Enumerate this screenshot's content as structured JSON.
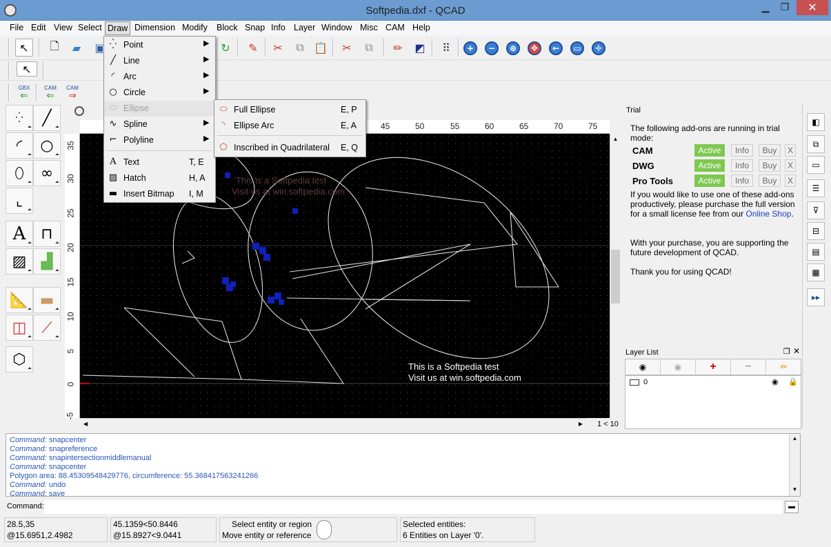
{
  "window": {
    "title": "Softpedia.dxf - QCAD",
    "minimize": "▁",
    "maximize": "❐",
    "close": "✕"
  },
  "menubar": [
    "File",
    "Edit",
    "View",
    "Select",
    "Draw",
    "Dimension",
    "Modify",
    "Block",
    "Snap",
    "Info",
    "Layer",
    "Window",
    "Misc",
    "CAM",
    "Help"
  ],
  "cam_buttons": {
    "gbx": "GBX",
    "cam1": "CAM",
    "cam2": "CAM"
  },
  "draw_menu": {
    "items": [
      {
        "label": "Point",
        "shortcut": "",
        "submenu": true,
        "icon": "point-icon",
        "glyph": "⁛"
      },
      {
        "label": "Line",
        "shortcut": "",
        "submenu": true,
        "icon": "line-icon",
        "glyph": "╱"
      },
      {
        "label": "Arc",
        "shortcut": "",
        "submenu": true,
        "icon": "arc-icon",
        "glyph": "◜"
      },
      {
        "label": "Circle",
        "shortcut": "",
        "submenu": true,
        "icon": "circle-icon",
        "glyph": "○"
      },
      {
        "label": "Ellipse",
        "shortcut": "",
        "submenu": true,
        "icon": "ellipse-icon",
        "glyph": "⬭",
        "disabled": true
      },
      {
        "label": "Spline",
        "shortcut": "",
        "submenu": true,
        "icon": "spline-icon",
        "glyph": "∿"
      },
      {
        "label": "Polyline",
        "shortcut": "",
        "submenu": true,
        "icon": "polyline-icon",
        "glyph": "⌐"
      },
      {
        "label": "Text",
        "shortcut": "T, E",
        "submenu": false,
        "icon": "text-icon",
        "glyph": "A"
      },
      {
        "label": "Hatch",
        "shortcut": "H, A",
        "submenu": false,
        "icon": "hatch-icon",
        "glyph": "▨"
      },
      {
        "label": "Insert Bitmap",
        "shortcut": "I, M",
        "submenu": false,
        "icon": "bitmap-icon",
        "glyph": "▬"
      }
    ],
    "arrow": "▶"
  },
  "ellipse_submenu": [
    {
      "label": "Full Ellipse",
      "shortcut": "E, P"
    },
    {
      "label": "Ellipse Arc",
      "shortcut": "E, A"
    },
    {
      "label": "Inscribed in Quadrilateral",
      "shortcut": "E, Q"
    }
  ],
  "ruler": {
    "top": [
      "45",
      "50",
      "55",
      "60",
      "65",
      "70",
      "75"
    ],
    "left": [
      "35",
      "30",
      "25",
      "20",
      "15",
      "10",
      "5",
      "0",
      "-5"
    ]
  },
  "drawing_text": {
    "line1": "This is a Softpedia test",
    "line2": "Visit us at win.softpedia.com",
    "faded1": "This is a Softpedia test",
    "faded2": "Visit us at win.softpedia.com"
  },
  "page_info": "1 < 10",
  "trial_panel": {
    "title": "Trial",
    "intro": "The following add-ons are running in trial mode:",
    "addons": [
      {
        "name": "CAM",
        "status": "Active",
        "info": "Info",
        "buy": "Buy",
        "close": "X"
      },
      {
        "name": "DWG",
        "status": "Active",
        "info": "Info",
        "buy": "Buy",
        "close": "X"
      },
      {
        "name": "Pro Tools",
        "status": "Active",
        "info": "Info",
        "buy": "Buy",
        "close": "X"
      }
    ],
    "paragraph1": "If you would like to use one of these add-ons productively, please purchase the full version for a small license fee from our",
    "link": "Online Shop",
    "link_suffix": ".",
    "paragraph2": "With your purchase, you are supporting the future development of QCAD.",
    "paragraph3": "Thank you for using QCAD!"
  },
  "layer_list": {
    "title": "Layer List",
    "layers": [
      {
        "name": "0"
      }
    ]
  },
  "command_history": [
    {
      "label": "Command:",
      "value": "snapcenter"
    },
    {
      "label": "Command:",
      "value": "snapreference"
    },
    {
      "label": "Command:",
      "value": "snapintersectionmiddlemanual"
    },
    {
      "label": "Command:",
      "value": "snapcenter"
    },
    {
      "label": "",
      "value": "Polygon area: 88.45309548429776, circumference: 55.368417563241266"
    },
    {
      "label": "Command:",
      "value": "undo"
    },
    {
      "label": "Command:",
      "value": "save"
    }
  ],
  "command_prompt": "Command:",
  "status": {
    "coord_abs": "28.5,35",
    "coord_rel": "@15.6951,2.4982",
    "polar_abs": "45.1359<50.8446",
    "polar_rel": "@15.8927<9.0441",
    "hint1": "Select entity or region",
    "hint2": "Move entity or reference",
    "sel_title": "Selected entities:",
    "sel_info": "6 Entities on Layer '0'."
  },
  "colors": {
    "titlebar": "#6b9bd1",
    "active": "#7ec850",
    "command": "#2855b4",
    "close": "#c75050"
  }
}
